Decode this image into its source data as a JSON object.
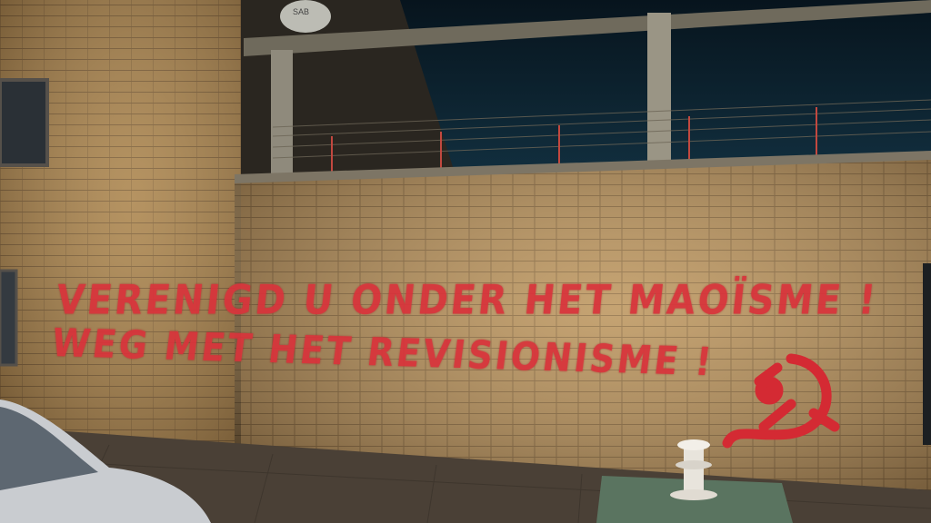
{
  "graffiti": {
    "line1": "VERENIGD U ONDER HET MAOÏSME !",
    "line2": "WEG MET HET REVISIONISME !"
  },
  "sign": {
    "text": "SAB"
  },
  "symbol": "hammer-and-sickle",
  "colors": {
    "sky": "#0d1e2a",
    "brick": "#b8905a",
    "brick_dark": "#6e5335",
    "paint": "#d9333b",
    "pavement": "#4a4036"
  }
}
